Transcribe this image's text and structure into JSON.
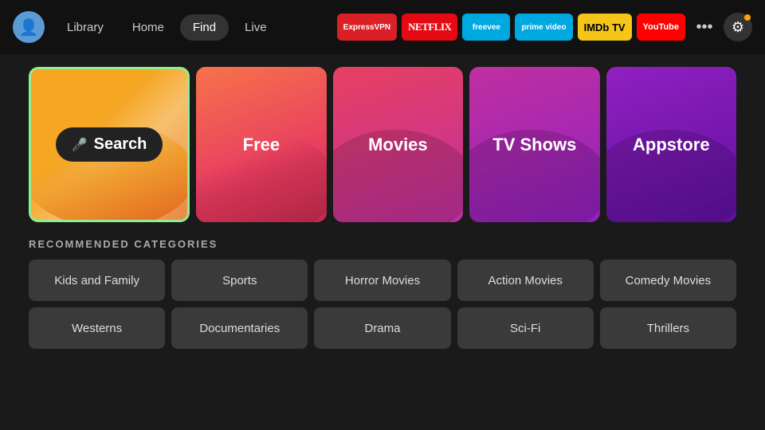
{
  "nav": {
    "avatar_icon": "👤",
    "links": [
      {
        "label": "Library",
        "active": false
      },
      {
        "label": "Home",
        "active": false
      },
      {
        "label": "Find",
        "active": true
      },
      {
        "label": "Live",
        "active": false
      }
    ],
    "apps": [
      {
        "id": "expressvpn",
        "label": "ExpressVPN",
        "class": "app-expressvpn",
        "text_class": "vpn-text"
      },
      {
        "id": "netflix",
        "label": "NETFLIX",
        "class": "app-netflix",
        "text_class": "netflix-text"
      },
      {
        "id": "freevee",
        "label": "freevee",
        "class": "app-freevee",
        "text_class": "freevee-text"
      },
      {
        "id": "prime",
        "label": "prime video",
        "class": "app-prime",
        "text_class": "prime-text"
      },
      {
        "id": "imdb",
        "label": "IMDb TV",
        "class": "app-imdb",
        "text_class": "imdb-text"
      },
      {
        "id": "youtube",
        "label": "YouTube",
        "class": "app-youtube",
        "text_class": "yt-text"
      }
    ],
    "more_icon": "•••",
    "settings_icon": "⚙"
  },
  "hero": {
    "search": {
      "label": "Search",
      "mic": "🎤"
    },
    "tiles": [
      {
        "id": "free",
        "label": "Free"
      },
      {
        "id": "movies",
        "label": "Movies"
      },
      {
        "id": "tvshows",
        "label": "TV Shows"
      },
      {
        "id": "appstore",
        "label": "Appstore"
      }
    ]
  },
  "recommended": {
    "section_title": "RECOMMENDED CATEGORIES",
    "categories": [
      "Kids and Family",
      "Sports",
      "Horror Movies",
      "Action Movies",
      "Comedy Movies",
      "Westerns",
      "Documentaries",
      "Drama",
      "Sci-Fi",
      "Thrillers"
    ]
  }
}
